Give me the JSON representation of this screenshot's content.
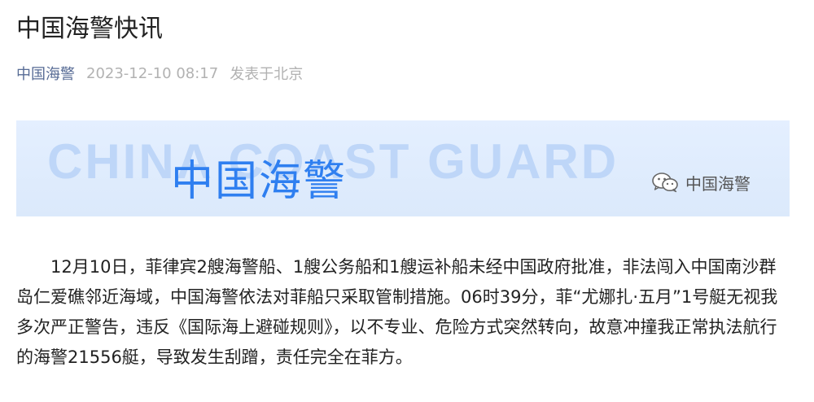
{
  "article": {
    "title": "中国海警快讯",
    "author": "中国海警",
    "date": "2023-12-10 08:17",
    "location": "发表于北京",
    "paragraph": "12月10日，菲律宾2艘海警船、1艘公务船和1艘运补船未经中国政府批准，非法闯入中国南沙群岛仁爱礁邻近海域，中国海警依法对菲船只采取管制措施。06时39分，菲“尤娜扎·五月”1号艇无视我多次严正警告，违反《国际海上避碰规则》，以不专业、危险方式突然转向，故意冲撞我正常执法航行的海警21556艇，导致发生刮蹭，责任完全在菲方。"
  },
  "banner": {
    "english_text": "CHINA COAST GUARD",
    "chinese_text": "中国海警",
    "badge_label": "中国海警",
    "badge_icon": "wechat-icon",
    "background_color": "#dfecfd",
    "accent_color": "#2f7ff0"
  },
  "colors": {
    "author_link": "#576b95",
    "meta_gray": "#b2b2b2",
    "text": "#222222"
  }
}
